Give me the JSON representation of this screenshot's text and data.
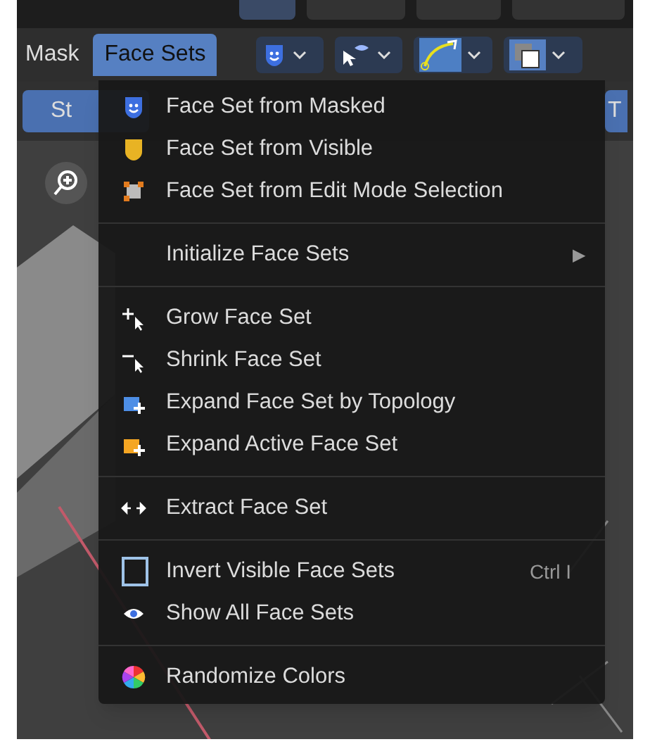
{
  "header": {
    "mode_label": "Mask",
    "menu_button": {
      "label": "Face Sets",
      "selected": true
    }
  },
  "toolbar": {
    "left_button": "St",
    "right_button": "T"
  },
  "menu": {
    "items": [
      {
        "kind": "item",
        "label": "Face Set from Masked"
      },
      {
        "kind": "item",
        "label": "Face Set from Visible"
      },
      {
        "kind": "item",
        "label": "Face Set from Edit Mode Selection"
      },
      {
        "kind": "separator"
      },
      {
        "kind": "submenu",
        "label": "Initialize Face Sets",
        "arrow": "▶"
      },
      {
        "kind": "separator"
      },
      {
        "kind": "item",
        "label": "Grow Face Set"
      },
      {
        "kind": "item",
        "label": "Shrink Face Set"
      },
      {
        "kind": "item",
        "label": "Expand Face Set by Topology"
      },
      {
        "kind": "item",
        "label": "Expand Active Face Set"
      },
      {
        "kind": "separator"
      },
      {
        "kind": "item",
        "label": "Extract Face Set"
      },
      {
        "kind": "separator"
      },
      {
        "kind": "item",
        "label": "Invert Visible Face Sets",
        "shortcut": "Ctrl I"
      },
      {
        "kind": "item",
        "label": "Show All Face Sets"
      },
      {
        "kind": "separator"
      },
      {
        "kind": "item",
        "label": "Randomize Colors"
      }
    ]
  }
}
